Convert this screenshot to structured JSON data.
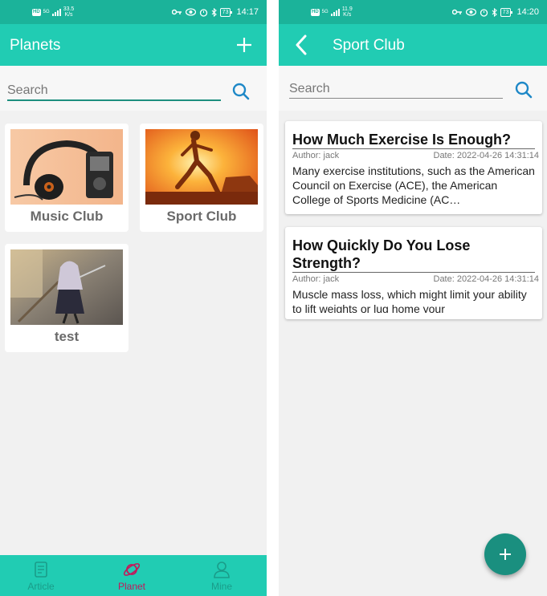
{
  "left": {
    "status": {
      "hd": "HD",
      "net": "5G",
      "speed_num": "33.5",
      "speed_unit": "K/s",
      "battery": "73",
      "time": "14:17"
    },
    "appbar": {
      "title": "Planets"
    },
    "search": {
      "placeholder": "Search"
    },
    "clubs": [
      {
        "name": "Music Club",
        "image": "headphones-photo"
      },
      {
        "name": "Sport Club",
        "image": "runner-sunset-photo"
      },
      {
        "name": "test",
        "image": "anime-illustration"
      }
    ],
    "nav": {
      "items": [
        {
          "label": "Article",
          "icon": "article-icon"
        },
        {
          "label": "Planet",
          "icon": "planet-icon",
          "active": true
        },
        {
          "label": "Mine",
          "icon": "person-icon"
        }
      ]
    }
  },
  "right": {
    "status": {
      "hd": "HD",
      "net": "5G",
      "speed_num": "11.9",
      "speed_unit": "K/s",
      "battery": "73",
      "time": "14:20"
    },
    "appbar": {
      "title": "Sport Club"
    },
    "search": {
      "placeholder": "Search"
    },
    "articles": [
      {
        "title": "How Much Exercise Is Enough?",
        "author": "Author: jack",
        "date": "Date: 2022-04-26 14:31:14",
        "excerpt": "Many exercise institutions, such as the American Council on Exercise (ACE), the American College of Sports Medicine (AC…"
      },
      {
        "title": "How Quickly Do You Lose Strength?",
        "author": "Author: jack",
        "date": "Date: 2022-04-26 14:31:14",
        "excerpt": "Muscle mass loss, which might limit your ability to lift weights or lug home your"
      }
    ]
  },
  "colors": {
    "primary": "#21ccb3",
    "statusbar": "#1bb39a",
    "fab": "#1a8f7f",
    "active_nav": "#c2185b",
    "search_icon": "#1e88c7"
  }
}
